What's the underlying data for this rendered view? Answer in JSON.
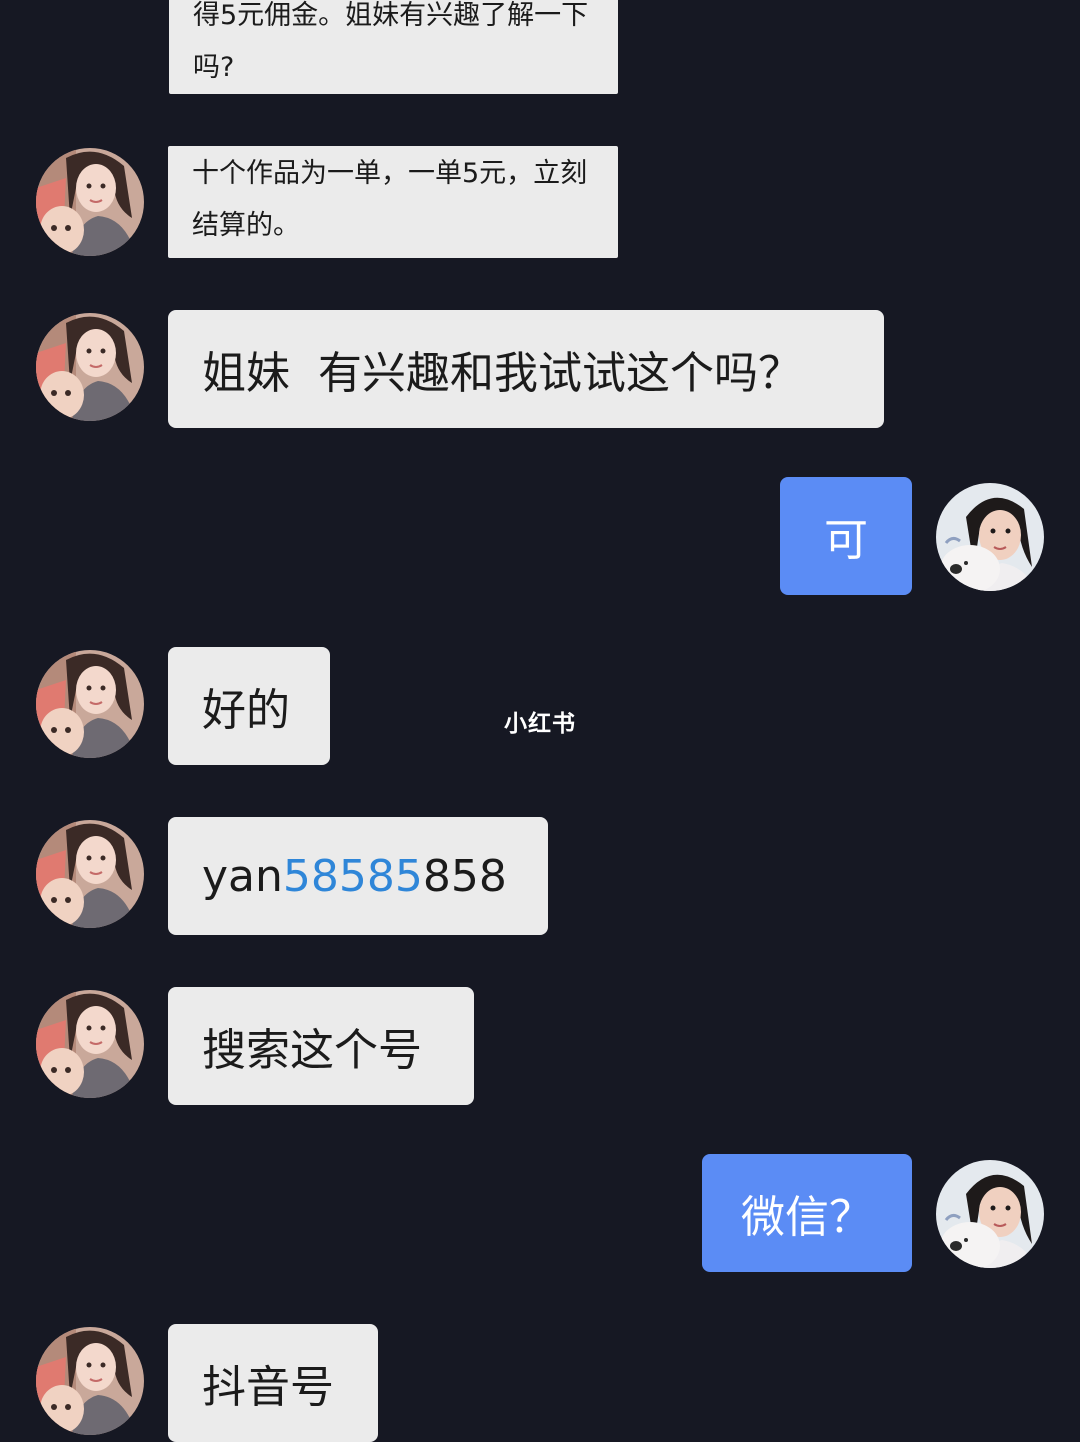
{
  "watermark": "小红书",
  "messages": [
    {
      "from": "other",
      "text": "得5元佣金。姐妹有兴趣了解一下吗?"
    },
    {
      "from": "other",
      "text": "十个作品为一单，一单5元，立刻结算的。"
    },
    {
      "from": "other",
      "text": "姐妹  有兴趣和我试试这个吗？"
    },
    {
      "from": "me",
      "text": "可"
    },
    {
      "from": "other",
      "text": "好的"
    },
    {
      "from": "other",
      "text_prefix": "yan",
      "text_link": "58585",
      "text_suffix": "858"
    },
    {
      "from": "other",
      "text": "搜索这个号"
    },
    {
      "from": "me",
      "text": "微信？"
    },
    {
      "from": "other",
      "text": "抖音号"
    }
  ],
  "colors": {
    "background": "#161823",
    "incoming_bubble": "#ebebeb",
    "outgoing_bubble": "#5b8cf5",
    "link": "#2f86d8"
  },
  "icons": {
    "other_avatar": "woman-with-baby-avatar",
    "my_avatar": "woman-with-plush-toy-avatar"
  }
}
